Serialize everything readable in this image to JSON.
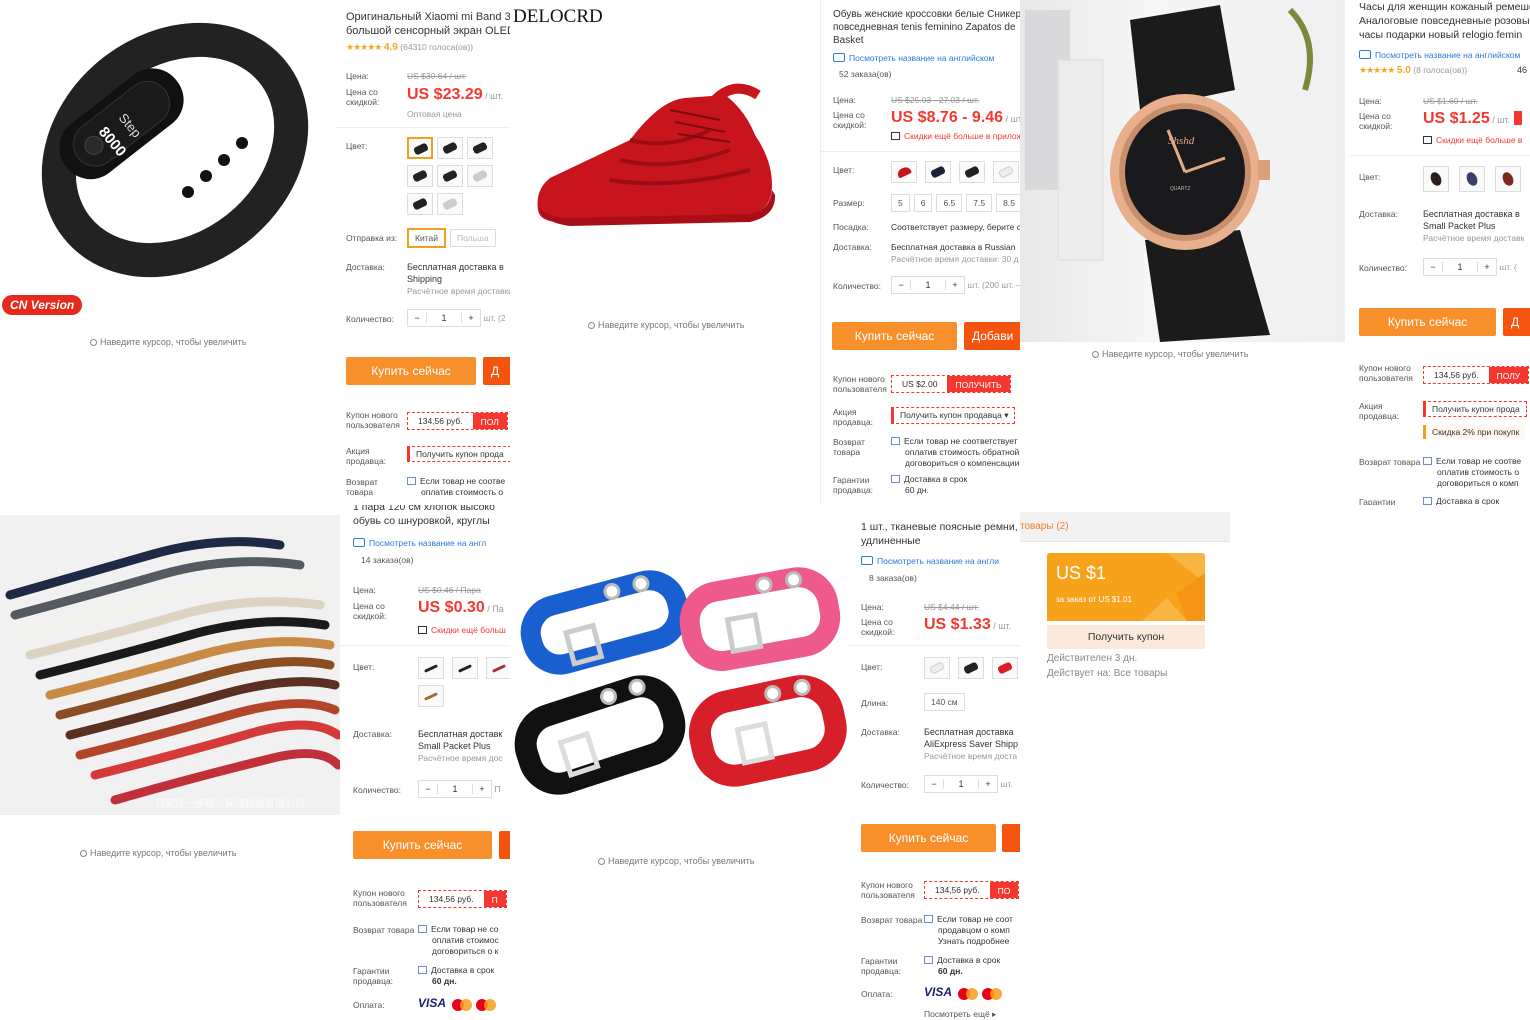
{
  "p1": {
    "badge": "CN Version",
    "zoom_hint": "Наведите курсор, чтобы увеличить",
    "screen_line1": "Step",
    "screen_line2": "8000",
    "title1": "Оригинальный Xiaomi mi Band 3",
    "title2": "большой сенсорный экран OLED",
    "stars": "★★★★★",
    "rating": "4.9",
    "votes": "(64310 голоса(ов))",
    "price_label": "Цена:",
    "old_price": "US $30.64 / шт.",
    "discount_label": "Цена со скидкой:",
    "price": "US $23.29",
    "unit": "/ шт.",
    "wholesale": "Оптовая цена",
    "color_label": "Цвет:",
    "ship_from_label": "Отправка из:",
    "ship_from_options": [
      "Китай",
      "Польша"
    ],
    "delivery_label": "Доставка:",
    "delivery": "Бесплатная доставка в",
    "delivery2": "Shipping",
    "delivery_time": "Расчётное время доставки",
    "qty_label": "Количество:",
    "qty": "1",
    "qty_unit": "шт. (2",
    "buy": "Купить сейчас",
    "cart": "Д",
    "new_user_coupon_label": "Купон нового пользователя",
    "coupon_amount": "134,56 руб.",
    "coupon_get": "ПОЛ",
    "promo_label": "Акция продавца:",
    "promo": "Получить купон прода",
    "return_label": "Возврат товара",
    "return1": "Если товар не соотве",
    "return2": "оплатив стоимость о"
  },
  "p2": {
    "brand": "DELOCRD",
    "zoom_hint": "Наведите курсор, чтобы увеличить",
    "title1": "Обувь женские кроссовки белые Сникерс",
    "title2": "повседневная tenis feminino Zapatos de",
    "title3": "Basket",
    "translate": "Посмотреть название на английском",
    "orders": "52 заказа(ов)",
    "price_label": "Цена:",
    "old_price": "US $25.03 - 27.03 / шт.",
    "discount_label": "Цена со скидкой:",
    "price": "US $8.76 - 9.46",
    "unit": "/ шт.",
    "app_discount": "Скидки ещё больше в прилож",
    "color_label": "Цвет:",
    "size_label": "Размер:",
    "sizes": [
      "5",
      "6",
      "6.5",
      "7.5",
      "8.5"
    ],
    "fit_label": "Посадка:",
    "fit": "Соответствует размеру, берите с",
    "delivery_label": "Доставка:",
    "delivery": "Бесплатная доставка в Russian",
    "delivery_time": "Расчётное время доставки: 30 д",
    "qty_label": "Количество:",
    "qty": "1",
    "qty_unit": "шт. (200 шт. –",
    "buy": "Купить сейчас",
    "cart": "Добави",
    "new_user_coupon_label": "Купон нового пользователя",
    "coupon_amount": "US $2.00",
    "coupon_get": "ПОЛУЧИТЬ",
    "promo_label": "Акция продавца:",
    "promo": "Получить купон продавца ▾",
    "return_label": "Возврат товара",
    "return1": "Если товар не соответствует",
    "return2": "оплатив стоимость обратной",
    "return3": "договориться о компенсации",
    "guarantee_label": "Гарантии продавца:",
    "guarantee1": "Доставка в срок",
    "guarantee2": "60 дн."
  },
  "p3": {
    "zoom_hint": "Наведите курсор, чтобы увеличить",
    "watch_brand": "Shshd",
    "watch_sub": "QUARTZ",
    "title1": "Часы для женщин кожаный ремешок",
    "title2": "Аналоговые повседневные розовые",
    "title3": "часы подарки новый relogio femin",
    "translate": "Посмотреть название на английском",
    "stars": "★★★★★",
    "rating": "5.0",
    "votes": "(8 голоса(ов))",
    "orders_short": "46",
    "price_label": "Цена:",
    "old_price": "US $1.60 / шт.",
    "discount_label": "Цена со скидкой:",
    "price": "US $1.25",
    "unit": "/ шт.",
    "app_discount": "Скидки ещё больше в",
    "color_label": "Цвет:",
    "delivery_label": "Доставка:",
    "delivery": "Бесплатная доставка в",
    "delivery2": "Small Packet Plus",
    "delivery_time": "Расчётное время доставк",
    "qty_label": "Количество:",
    "qty": "1",
    "qty_unit": "шт. (",
    "buy": "Купить сейчас",
    "cart": "Д",
    "new_user_coupon_label": "Купон нового пользователя",
    "coupon_amount": "134,56 руб.",
    "coupon_get": "ПОЛУ",
    "promo_label": "Акция продавца:",
    "promo": "Получить купон прода",
    "promo2": "Скидка 2% при покупк",
    "return_label": "Возврат товара",
    "return1": "Если товар не соотве",
    "return2": "оплатив стоимость о",
    "return3": "договориться о комп",
    "guarantee_label": "Гарантии",
    "guarantee1": "Доставка в срок"
  },
  "p4": {
    "zoom_hint": "Наведите курсор, чтобы увеличить",
    "watermark": "石家庄一步鞋业网络科技有限公司",
    "title0": "1 пара 120 см хлопок высоко",
    "title1": "обувь со шнуровкой, круглы",
    "translate": "Посмотреть название на англ",
    "orders": "14 заказа(ов)",
    "price_label": "Цена:",
    "old_price": "US $0.46 / Пара",
    "discount_label": "Цена со скидкой:",
    "price": "US $0.30",
    "unit": "/ Па",
    "app_discount": "Скидки ещё больш",
    "color_label": "Цвет:",
    "delivery_label": "Доставка:",
    "delivery": "Бесплатная доставк",
    "delivery2": "Small Packet Plus",
    "delivery_time": "Расчётное время дос",
    "qty_label": "Количество:",
    "qty": "1",
    "qty_unit": "П",
    "buy": "Купить сейчас",
    "new_user_coupon_label": "Купон нового пользователя",
    "coupon_amount": "134,56 руб.",
    "coupon_get": "П",
    "return_label": "Возврат товара",
    "return1": "Если товар не со",
    "return2": "оплатив стоимос",
    "return3": "договориться о к",
    "guarantee_label": "Гарантии продавца:",
    "guarantee1": "Доставка в срок",
    "guarantee2": "60 дн.",
    "payment_label": "Оплата:",
    "visa": "VISA"
  },
  "p5": {
    "zoom_hint": "Наведите курсор, чтобы увеличить",
    "title1": "1 шт., тканевые поясные ремни,",
    "title2": "удлиненные",
    "translate": "Посмотреть название на англи",
    "orders": "8 заказа(ов)",
    "price_label": "Цена:",
    "old_price": "US $4.44 / шт.",
    "discount_label": "Цена со скидкой:",
    "price": "US $1.33",
    "unit": "/ шт.",
    "color_label": "Цвет:",
    "length_label": "Длина:",
    "length": "140 см",
    "delivery_label": "Доставка:",
    "delivery": "Бесплатная доставка",
    "delivery2": "AliExpress Saver Shipp",
    "delivery_time": "Расчётное время доста",
    "qty_label": "Количество:",
    "qty": "1",
    "qty_unit": "шт.",
    "buy": "Купить сейчас",
    "new_user_coupon_label": "Купон нового пользователя",
    "coupon_amount": "134,56 руб.",
    "coupon_get": "ПО",
    "return_label": "Возврат товара",
    "return1": "Если товар не соот",
    "return2": "продавцом о комп",
    "return3": "Узнать подробнее",
    "guarantee_label": "Гарантии продавца:",
    "guarantee1": "Доставка в срок",
    "guarantee2": "60 дн.",
    "payment_label": "Оплата:",
    "visa": "VISA",
    "more": "Посмотреть ещё ▸"
  },
  "p6": {
    "header": "товары (2)",
    "coupon_value": "US $1",
    "coupon_cond": "за заказ от US $1.01",
    "get_coupon": "Получить купон",
    "valid": "Действителен 3 дн.",
    "applies": "Действует на: Все товары"
  },
  "colors": {
    "accent_red": "#f5382f",
    "buy_orange": "#f7902b",
    "cart_orange": "#f5540e",
    "coupon_card": "#f7a21b"
  }
}
